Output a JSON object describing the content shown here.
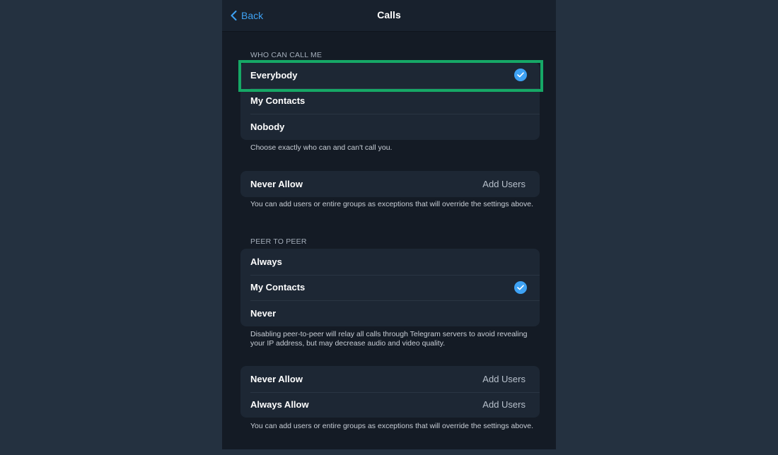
{
  "header": {
    "back_label": "Back",
    "title": "Calls"
  },
  "who_can_call": {
    "section_label": "WHO CAN CALL ME",
    "options": [
      {
        "label": "Everybody",
        "selected": true
      },
      {
        "label": "My Contacts",
        "selected": false
      },
      {
        "label": "Nobody",
        "selected": false
      }
    ],
    "footnote": "Choose exactly who can and can't call you."
  },
  "exceptions_1": {
    "rows": [
      {
        "label": "Never Allow",
        "value": "Add Users"
      }
    ],
    "footnote": "You can add users or entire groups as exceptions that will override the settings above."
  },
  "peer_to_peer": {
    "section_label": "PEER TO PEER",
    "options": [
      {
        "label": "Always",
        "selected": false
      },
      {
        "label": "My Contacts",
        "selected": true
      },
      {
        "label": "Never",
        "selected": false
      }
    ],
    "footnote": "Disabling peer-to-peer will relay all calls through Telegram servers to avoid revealing your IP address, but may decrease audio and video quality."
  },
  "exceptions_2": {
    "rows": [
      {
        "label": "Never Allow",
        "value": "Add Users"
      },
      {
        "label": "Always Allow",
        "value": "Add Users"
      }
    ],
    "footnote": "You can add users or entire groups as exceptions that will override the settings above."
  },
  "colors": {
    "accent": "#3ea2f4",
    "highlight": "#16a866",
    "background": "#243140",
    "panel": "#141b25",
    "group": "#1d2734"
  }
}
